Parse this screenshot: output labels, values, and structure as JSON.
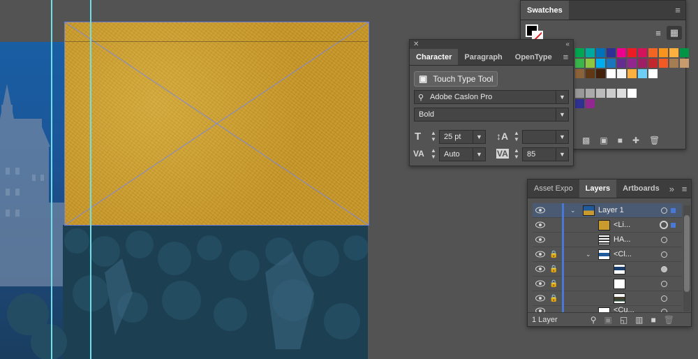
{
  "swatches_panel": {
    "tab_label": "Swatches",
    "menu_icon": "hamburger-menu-icon",
    "color_rows": [
      [
        "#00a651",
        "#00a99d",
        "#0072bc",
        "#2e3192",
        "#ec008c",
        "#ed1c24",
        "#d4145a",
        "#f26522",
        "#f7941d",
        "#fbb040"
      ],
      [
        "#009444",
        "#39b54a",
        "#8dc63f",
        "#00aeef",
        "#1b75bc",
        "#662d91",
        "#92278f",
        "#9e1f63",
        "#c1272d",
        "#f15a24"
      ],
      [
        "#a67c52",
        "#c69c6d",
        "#8c6239",
        "#603813",
        "#42210b",
        "#ffffff",
        "#f5f5f5",
        "#fbb040",
        "#6dcff6",
        "#ffffff"
      ]
    ],
    "gray_row": [
      "#999999",
      "#aaaaaa",
      "#bbbbbb",
      "#cccccc",
      "#dddddd",
      "#ffffff"
    ],
    "extra_row": [
      "#2e3192",
      "#92278f"
    ]
  },
  "character_panel": {
    "tabs": [
      "Character",
      "Paragraph",
      "OpenType"
    ],
    "touch_type_label": "Touch Type Tool",
    "font_family": "Adobe Caslon Pro",
    "font_style": "Bold",
    "font_size": "25 pt",
    "leading": "",
    "kerning": "Auto",
    "tracking": "85"
  },
  "layers_panel": {
    "tabs": [
      "Asset Expo",
      "Layers",
      "Artboards"
    ],
    "footer_text": "1 Layer",
    "rows": [
      {
        "name": "Layer 1"
      },
      {
        "name": "<Li..."
      },
      {
        "name": "HA..."
      },
      {
        "name": "<Cl..."
      },
      {
        "name": ""
      },
      {
        "name": ""
      },
      {
        "name": ""
      },
      {
        "name": "<Cu..."
      }
    ]
  }
}
